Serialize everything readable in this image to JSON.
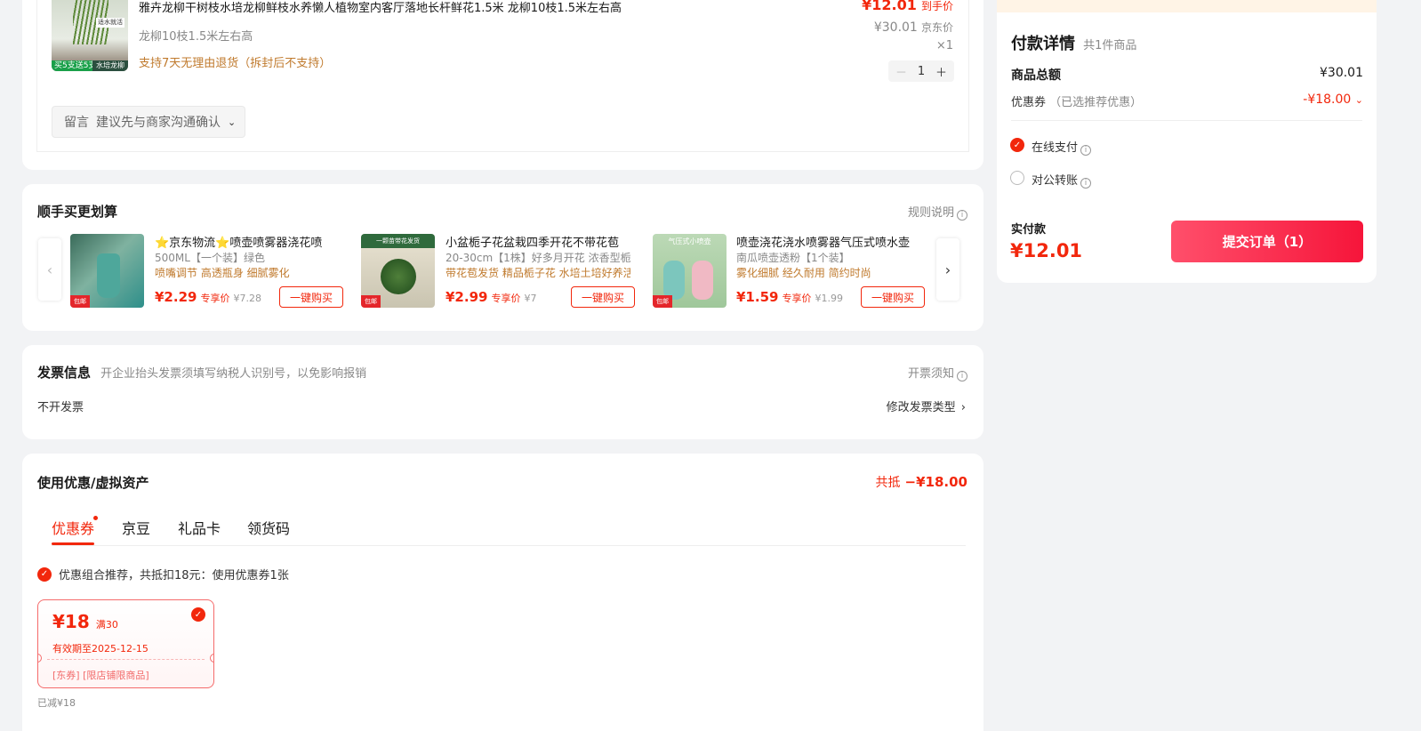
{
  "product": {
    "title": "雅卉龙柳干树枝水培龙柳鲜枝水养懒人植物室内客厅落地长杆鲜花1.5米 龙柳10枝1.5米左右高",
    "spec": "龙柳10枝1.5米左右高",
    "return_policy": "支持7天无理由退货（拆封后不支持）",
    "price": "¥12.01",
    "price_label": "到手价",
    "jd_price": "¥30.01",
    "jd_price_label": "京东价",
    "qty_text": "×1",
    "qty": "1",
    "minus": "－",
    "plus": "＋",
    "img_tag": "买5支送5支",
    "img_tag2": "水培龙柳",
    "img_label": "适水就活"
  },
  "note": {
    "label": "留言",
    "placeholder": "建议先与商家沟通确认"
  },
  "recommend": {
    "title": "顺手买更划算",
    "rules": "规则说明",
    "items": [
      {
        "title": "⭐京东物流⭐喷壶喷雾器浇花喷",
        "sub": "500ML【一个装】绿色",
        "tags": "喷嘴调节 高透瓶身 细腻雾化",
        "price": "¥2.29",
        "price_label": "专享价",
        "orig": "¥7.28",
        "buy": "一键购买",
        "badge": "包邮"
      },
      {
        "title": "小盆栀子花盆栽四季开花不带花苞",
        "sub": "20-30cm【1株】好多月开花 浓香型栀",
        "tags": "带花苞发货 精品栀子花 水培土培好养活",
        "price": "¥2.99",
        "price_label": "专享价",
        "orig": "¥7",
        "buy": "一键购买",
        "badge": "包邮"
      },
      {
        "title": "喷壶浇花浇水喷雾器气压式喷水壶",
        "sub": "南瓜喷壶透粉【1个装】",
        "tags": "雾化细腻 经久耐用 简约时尚",
        "price": "¥1.59",
        "price_label": "专享价",
        "orig": "¥1.99",
        "buy": "一键购买",
        "badge": "包邮"
      }
    ]
  },
  "invoice": {
    "title": "发票信息",
    "hint": "开企业抬头发票须填写纳税人识别号，以免影响报销",
    "notice": "开票须知",
    "value": "不开发票",
    "change": "修改发票类型"
  },
  "discount": {
    "title": "使用优惠/虚拟资产",
    "total_label": "共抵",
    "total_value": "−¥18.00",
    "tabs": [
      "优惠券",
      "京豆",
      "礼品卡",
      "领货码"
    ],
    "combo": "优惠组合推荐，共抵扣18元：使用优惠券1张",
    "coupon": {
      "amount": "¥18",
      "threshold": "满30",
      "expiry": "有效期至2025-12-15",
      "scope": "[东券] [限店铺限商品]"
    },
    "reduced": "已减¥18"
  },
  "payment": {
    "title": "付款详情",
    "count": "共1件商品",
    "goods_total_label": "商品总额",
    "goods_total": "¥30.01",
    "coupon_label": "优惠券",
    "coupon_note": "（已选推荐优惠）",
    "coupon_value": "-¥18.00",
    "online_pay": "在线支付",
    "corporate": "对公转账",
    "actual_label": "实付款",
    "actual_value": "¥12.01",
    "submit": "提交订单（1）"
  },
  "colors": {
    "accent": "#f2270c",
    "tag_orange": "#c07a2d",
    "bg": "#f2f3f5"
  }
}
